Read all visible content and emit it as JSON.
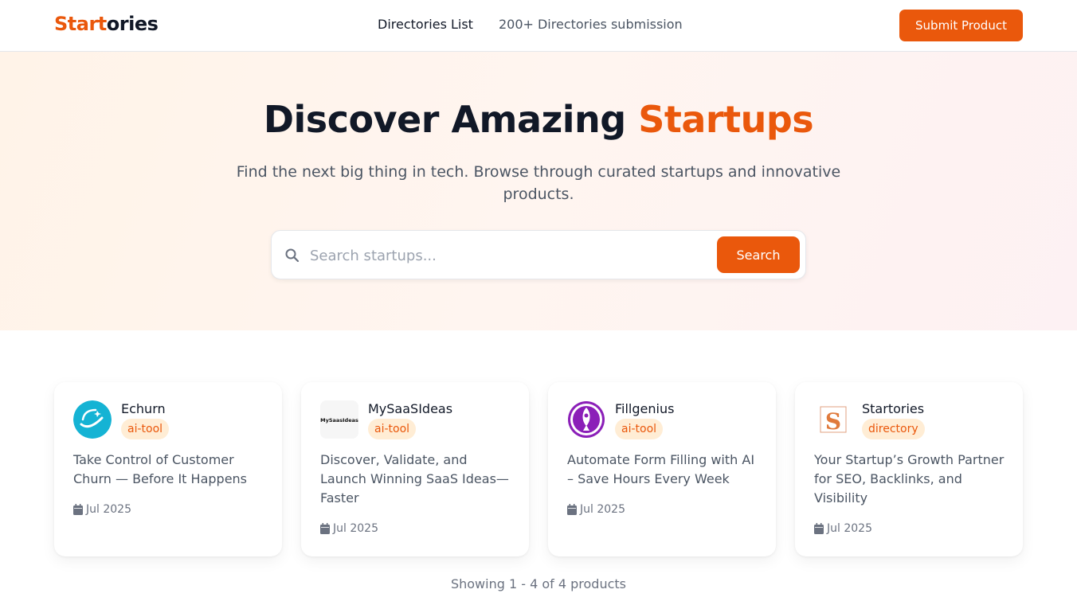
{
  "header": {
    "logo_part1": "Start",
    "logo_part2": "ories",
    "nav": [
      {
        "label": "Directories List"
      },
      {
        "label": "200+ Directories submission"
      }
    ],
    "submit_label": "Submit Product"
  },
  "hero": {
    "title_part1": "Discover Amazing",
    "title_part2": "Startups",
    "subtitle": "Find the next big thing in tech. Browse through curated startups and innovative products.",
    "search_placeholder": "Search startups...",
    "search_button": "Search",
    "search_icon": "search-icon"
  },
  "products": [
    {
      "name": "Echurn",
      "tag": "ai-tool",
      "description": "Take Control of Customer Churn — Before It Happens",
      "date": "Jul 2025",
      "logo_icon": "echurn-logo",
      "logo_color": "#15b3d4"
    },
    {
      "name": "MySaaSIdeas",
      "tag": "ai-tool",
      "description": "Discover, Validate, and Launch Winning SaaS Ideas—Faster",
      "date": "Jul 2025",
      "logo_icon": "mysaasideas-logo",
      "logo_text": "MySaasIdeas"
    },
    {
      "name": "Fillgenius",
      "tag": "ai-tool",
      "description": "Automate Form Filling with AI – Save Hours Every Week",
      "date": "Jul 2025",
      "logo_icon": "fillgenius-logo",
      "logo_color": "#8b1fb8"
    },
    {
      "name": "Startories",
      "tag": "directory",
      "description": "Your Startup’s Growth Partner for SEO, Backlinks, and Visibility",
      "date": "Jul 2025",
      "logo_icon": "startories-logo",
      "logo_letter": "S"
    }
  ],
  "pagination": {
    "summary": "Showing 1 - 4 of 4 products"
  },
  "colors": {
    "accent": "#ea580c",
    "tag_bg": "#ffedd5"
  }
}
